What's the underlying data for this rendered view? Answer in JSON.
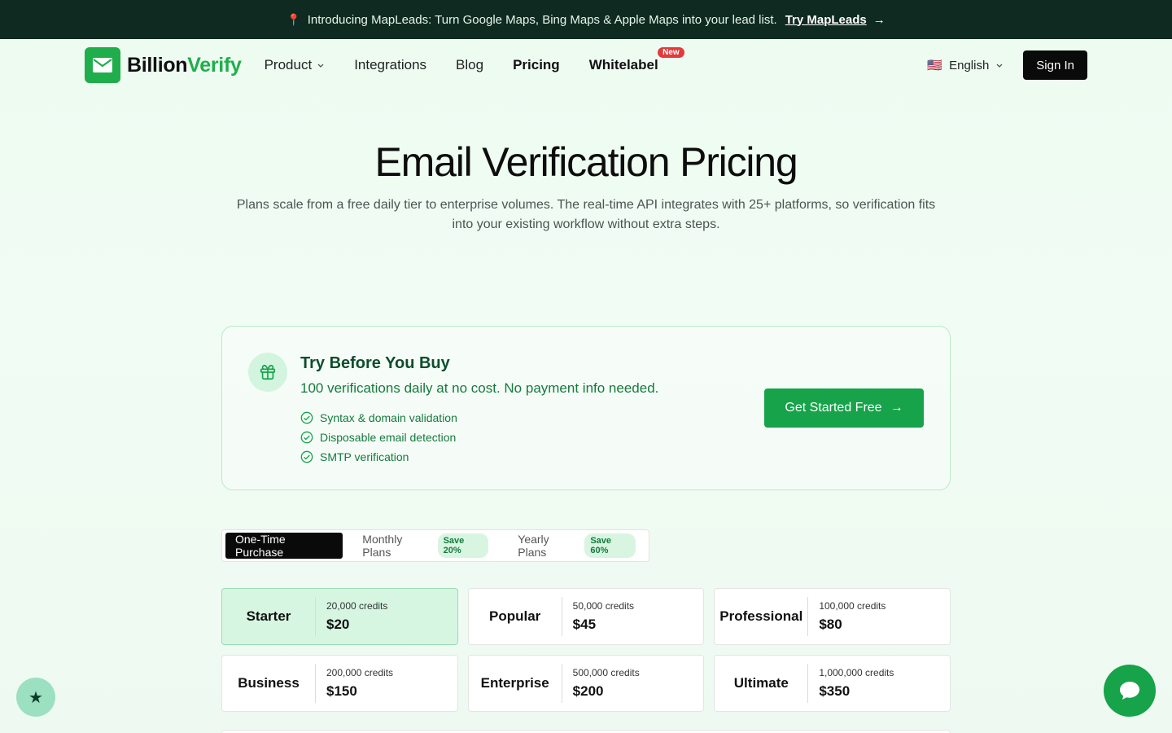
{
  "announcement": {
    "text": "Introducing MapLeads: Turn Google Maps, Bing Maps & Apple Maps into your lead list.",
    "link": "Try MapLeads",
    "icon": "pin-icon"
  },
  "nav": {
    "brand_part1": "Billion",
    "brand_part2": "Verify",
    "links": {
      "product": "Product",
      "integrations": "Integrations",
      "blog": "Blog",
      "pricing": "Pricing",
      "whitelabel": "Whitelabel"
    },
    "new_badge": "New",
    "language": "English",
    "flag": "🇺🇸",
    "sign_in": "Sign In"
  },
  "hero": {
    "title": "Email Verification Pricing",
    "subtitle": "Plans scale from a free daily tier to enterprise volumes. The real-time API integrates with 25+ platforms, so verification fits into your existing workflow without extra steps."
  },
  "trial": {
    "title": "Try Before You Buy",
    "subtitle": "100 verifications daily at no cost. No payment info needed.",
    "features": [
      "Syntax & domain validation",
      "Disposable email detection",
      "SMTP verification"
    ],
    "cta": "Get Started Free"
  },
  "tabs": {
    "one_time": "One-Time Purchase",
    "monthly": "Monthly Plans",
    "monthly_save": "Save 20%",
    "yearly": "Yearly Plans",
    "yearly_save": "Save 60%",
    "active": "One-Time Purchase"
  },
  "plans": [
    {
      "name": "Starter",
      "credits": "20,000 credits",
      "price": "$20",
      "selected": true
    },
    {
      "name": "Popular",
      "credits": "50,000 credits",
      "price": "$45",
      "selected": false
    },
    {
      "name": "Professional",
      "credits": "100,000 credits",
      "price": "$80",
      "selected": false
    },
    {
      "name": "Business",
      "credits": "200,000 credits",
      "price": "$150",
      "selected": false
    },
    {
      "name": "Enterprise",
      "credits": "500,000 credits",
      "price": "$200",
      "selected": false
    },
    {
      "name": "Ultimate",
      "credits": "1,000,000 credits",
      "price": "$350",
      "selected": false
    }
  ],
  "colors": {
    "brand_green": "#1fae4b",
    "cta_green": "#16a34a",
    "announce_bg": "#0f2a20"
  }
}
